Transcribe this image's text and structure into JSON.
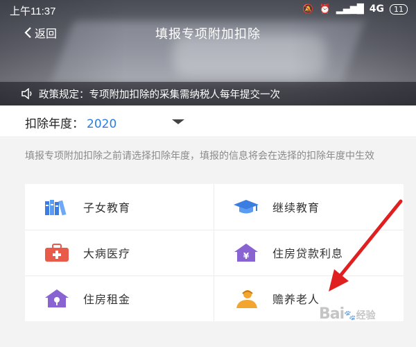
{
  "status": {
    "time": "上午11:37",
    "network": "4G",
    "battery": "11"
  },
  "nav": {
    "back_label": "返回",
    "title": "填报专项附加扣除"
  },
  "notice": {
    "text": "政策规定：专项附加扣除的采集需纳税人每年提交一次"
  },
  "year": {
    "label": "扣除年度：",
    "value": "2020"
  },
  "hint": "填报专项附加扣除之前请选择扣除年度，填报的信息将会在选择的扣除年度中生效",
  "categories": [
    {
      "label": "子女教育",
      "icon": "books-icon"
    },
    {
      "label": "继续教育",
      "icon": "graduation-cap-icon"
    },
    {
      "label": "大病医疗",
      "icon": "medical-kit-icon"
    },
    {
      "label": "住房贷款利息",
      "icon": "house-yen-icon"
    },
    {
      "label": "住房租金",
      "icon": "house-key-icon"
    },
    {
      "label": "赡养老人",
      "icon": "elderly-icon"
    }
  ],
  "colors": {
    "accent": "#2b7de0",
    "arrow": "#e02020"
  },
  "watermark": {
    "text1": "Bai",
    "text2": "经验"
  }
}
